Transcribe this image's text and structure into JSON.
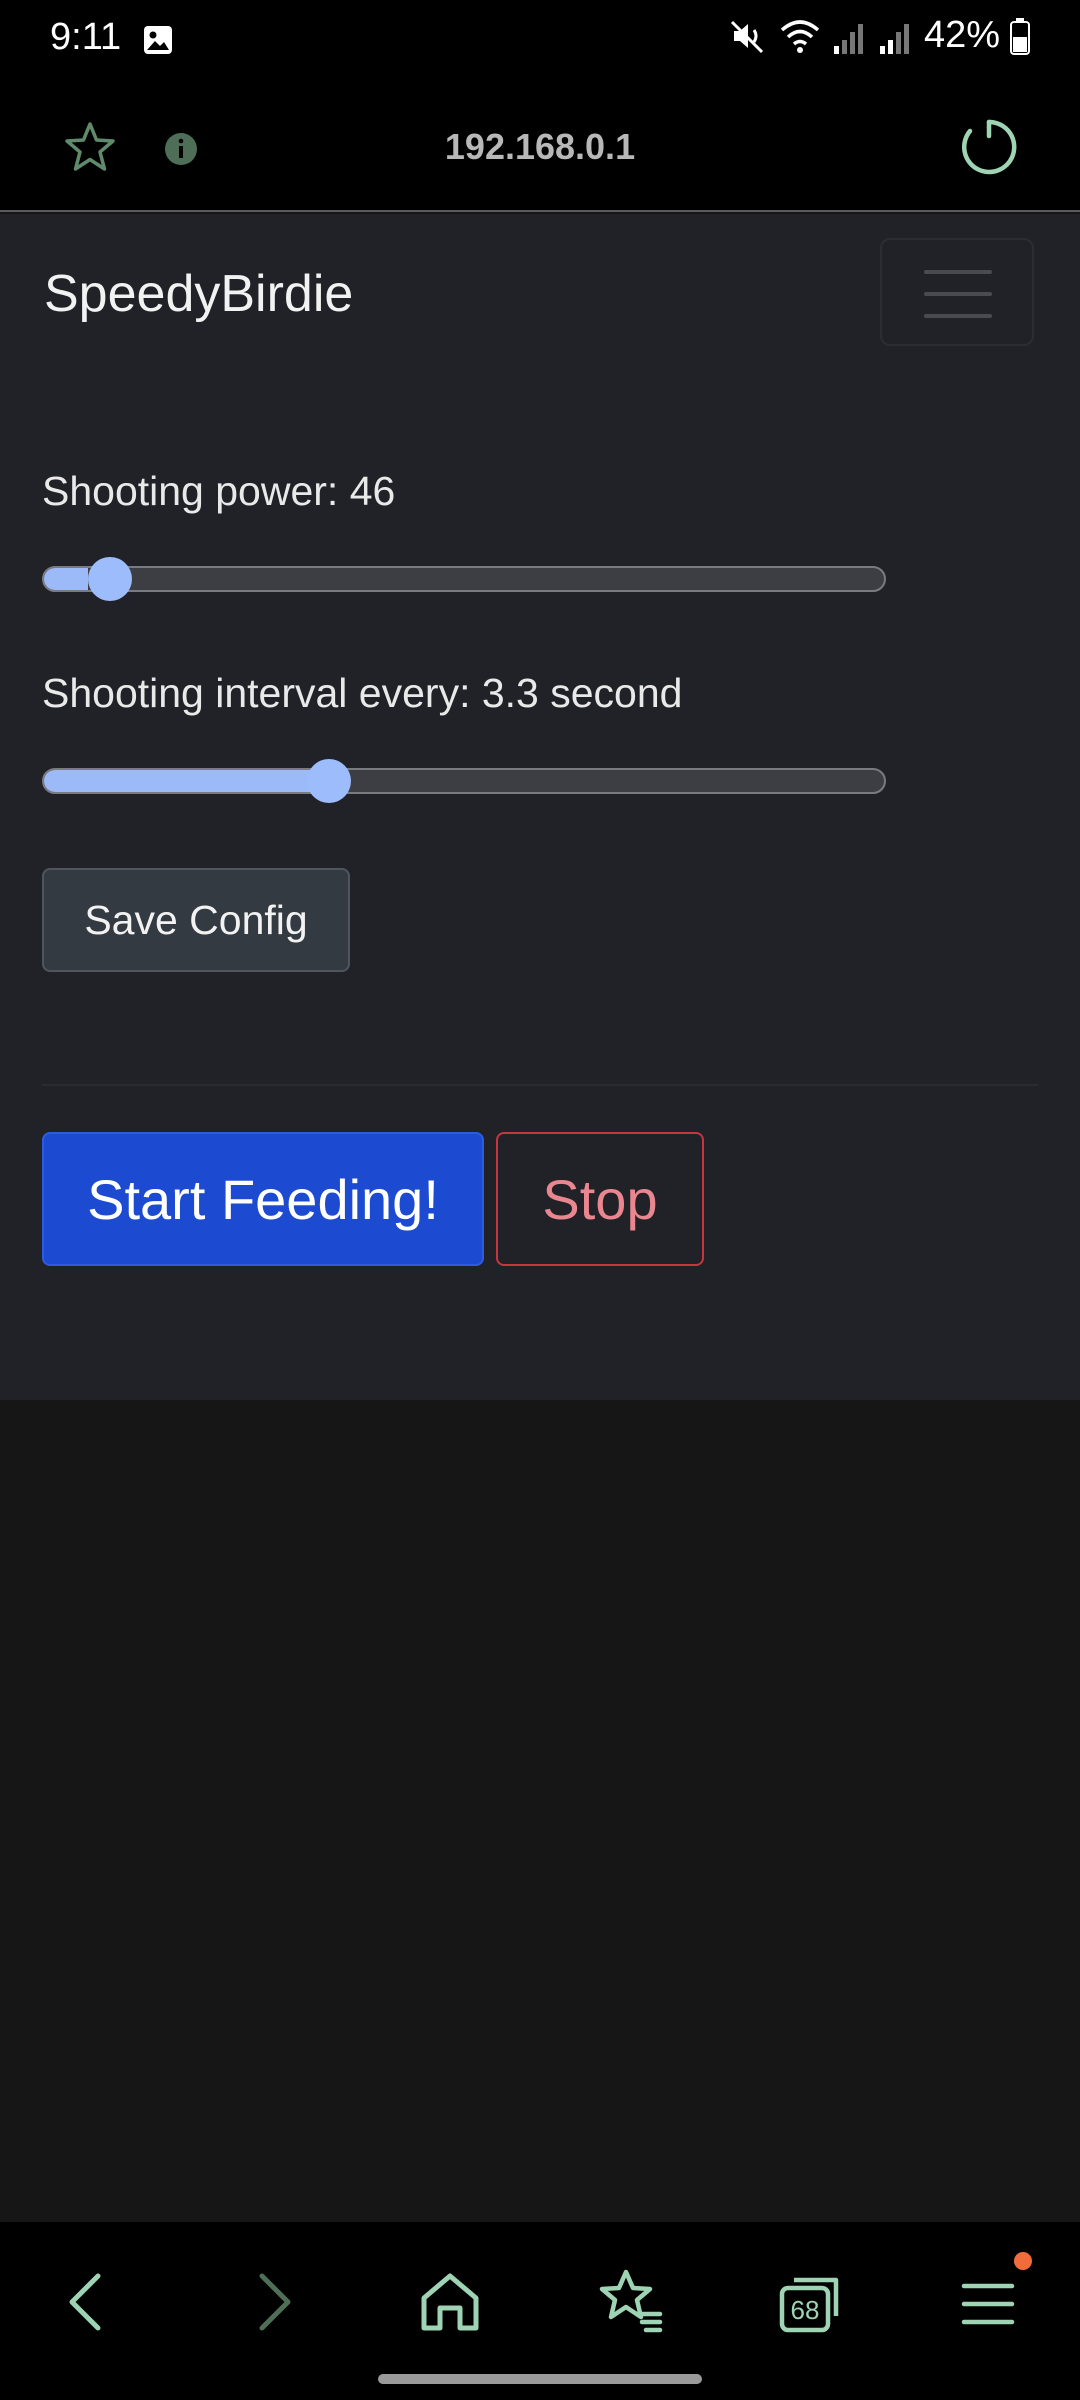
{
  "status_bar": {
    "time": "9:11",
    "battery": "42%"
  },
  "browser": {
    "url": "192.168.0.1",
    "tab_count": "68"
  },
  "app": {
    "brand": "SpeedyBirdie",
    "power_label": "Shooting power: 46",
    "power_value": 46,
    "interval_label": "Shooting interval every: 3.3  second",
    "interval_value": 3.3,
    "save_label": "Save Config",
    "start_label": "Start Feeding!",
    "stop_label": "Stop"
  },
  "colors": {
    "accent_primary": "#1c4ad0",
    "danger": "#c7353f",
    "slider": "#9bbaf7"
  }
}
